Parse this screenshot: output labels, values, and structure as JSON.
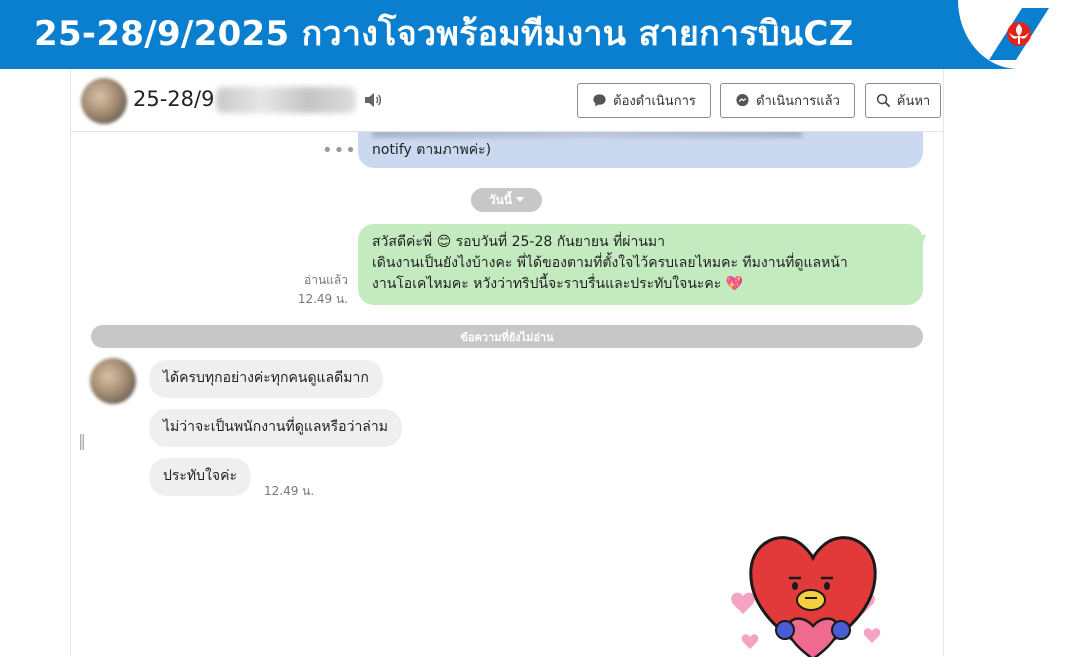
{
  "banner": {
    "title": "25-28/9/2025 กวางโจวพร้อมทีมงาน สายการบินCZ"
  },
  "header": {
    "chat_name": "25-28/9",
    "buttons": {
      "todo": "ต้องดำเนินการ",
      "done": "ดำเนินการแล้ว",
      "search": "ค้นหา"
    }
  },
  "messages": {
    "prev_bubble_tail": "notify ตามภาพค่ะ)",
    "more_menu": "•••",
    "date_separator": "วันนี้",
    "outgoing": {
      "line1": "สวัสดีค่ะพี่ 😊 รอบวันที่ 25-28 กันยายน ที่ผ่านมา",
      "line2": "เดินงานเป็นยังไงบ้างคะ พี่ได้ของตามที่ตั้งใจไว้ครบเลยไหมคะ ทีมงานที่ดูแลหน้า",
      "line3": "งานโอเคไหมคะ หวังว่าทริปนี้จะราบรื่นและประทับใจนะคะ 💖",
      "read_status": "อ่านแล้ว",
      "time": "12.49 น."
    },
    "unread_label": "ข้อความที่ยังไม่อ่าน",
    "incoming": [
      "ได้ครบทุกอย่างค่ะทุกคนดูแลดีมาก",
      "ไม่ว่าจะเป็นพนักงานที่ดูแลหรือว่าล่าม",
      "ประทับใจค่ะ"
    ],
    "incoming_time": "12.49 น."
  },
  "icons": {
    "logo": "china-southern-kapok-logo-icon",
    "speaker": "speaker-icon",
    "todo": "chat-bubble-icon",
    "done": "messenger-icon",
    "search": "search-icon"
  },
  "colors": {
    "banner": "#0a7fcf",
    "outgoing_bubble": "#c4ebbf",
    "previous_bubble": "#cbd9f0",
    "incoming_bubble": "#efefef",
    "pill": "#c7c7c7",
    "logo_red": "#e2231a"
  }
}
